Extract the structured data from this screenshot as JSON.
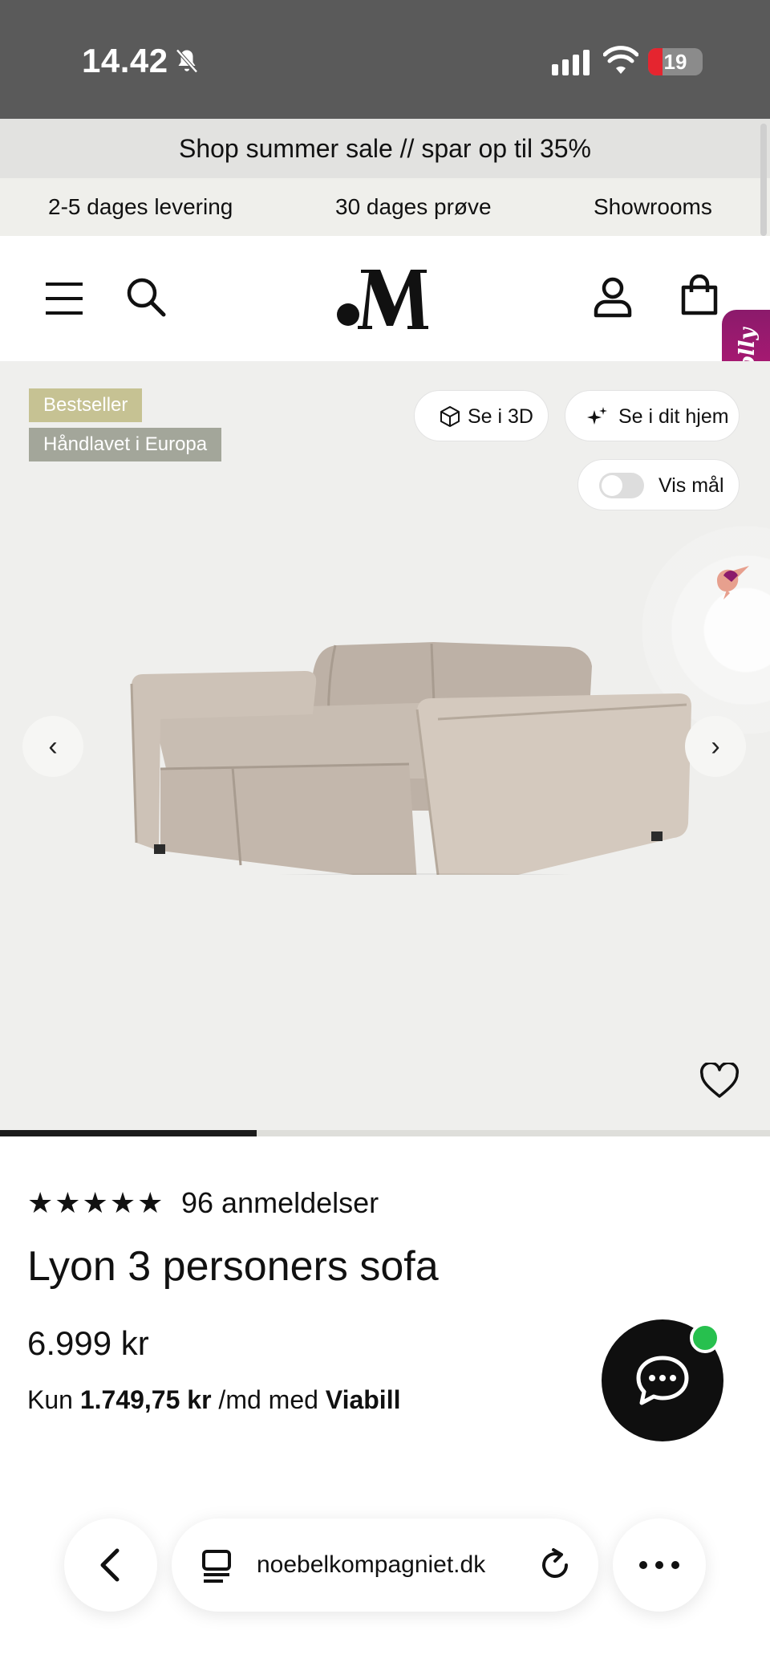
{
  "status_bar": {
    "time": "14.42",
    "battery": "19",
    "icons": [
      "bell-slash-icon",
      "signal-icon",
      "wifi-icon",
      "battery-icon"
    ]
  },
  "promo": {
    "text": "Shop summer sale // spar op til 35%"
  },
  "usp": {
    "items": [
      "2-5 dages levering",
      "30 dages prøve",
      "Showrooms"
    ]
  },
  "header": {
    "icons": [
      "menu-icon",
      "search-icon",
      "logo",
      "account-icon",
      "bag-icon"
    ]
  },
  "molly": {
    "label": "Molly"
  },
  "gallery": {
    "badges": [
      "Bestseller",
      "Håndlavet i Europa"
    ],
    "buttons": {
      "view_3d": "Se i 3D",
      "view_home": "Se i dit hjem",
      "show_dims": "Vis mål"
    },
    "toggle_on": false,
    "progress_fraction": 0.333,
    "image_alt": "sofa"
  },
  "product": {
    "stars": "★★★★★",
    "reviews": "96 anmeldelser",
    "title": "Lyon 3 personers sofa",
    "price": "6.999 kr",
    "finance_prefix": "Kun",
    "finance_amount": "1.749,75 kr",
    "finance_middle": "/md med",
    "finance_provider": "Viabill"
  },
  "browser": {
    "url": "noebelkompagniet.dk"
  },
  "colors": {
    "badge_bestseller": "#c6c293",
    "badge_handmade": "#a3a69a",
    "molly": "#b0176f",
    "chat_online": "#27c04e"
  }
}
